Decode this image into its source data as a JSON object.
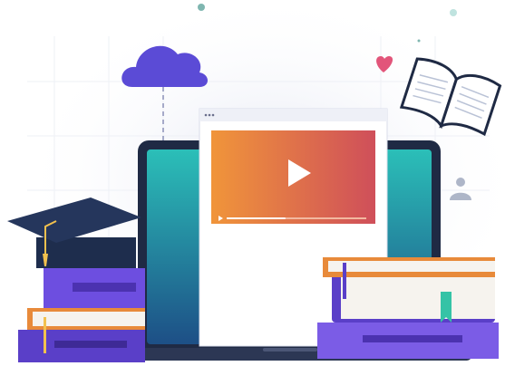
{
  "illustration": {
    "palette": {
      "laptop_frame": "#1f2a44",
      "screen_top": "#2bbfb8",
      "screen_bottom": "#1d4f86",
      "cloud": "#5b4bd6",
      "video_gradient_start": "#f0953a",
      "video_gradient_end": "#cf4f5a",
      "book_purple": "#6d4ee0",
      "book_cover_orange": "#e88a3a",
      "book_page": "#f6f3ee",
      "heart": "#e2557a",
      "cap": "#1e2d4d",
      "tassel": "#f2c14e",
      "bookmark": "#35c3a6"
    },
    "icons": {
      "cloud": "cloud-icon",
      "play": "play-icon",
      "heart": "heart-icon",
      "user": "user-icon",
      "open_book": "open-book-icon",
      "graduation_cap": "graduation-cap-icon"
    },
    "video_player": {
      "progress_fraction": 0.42
    }
  }
}
